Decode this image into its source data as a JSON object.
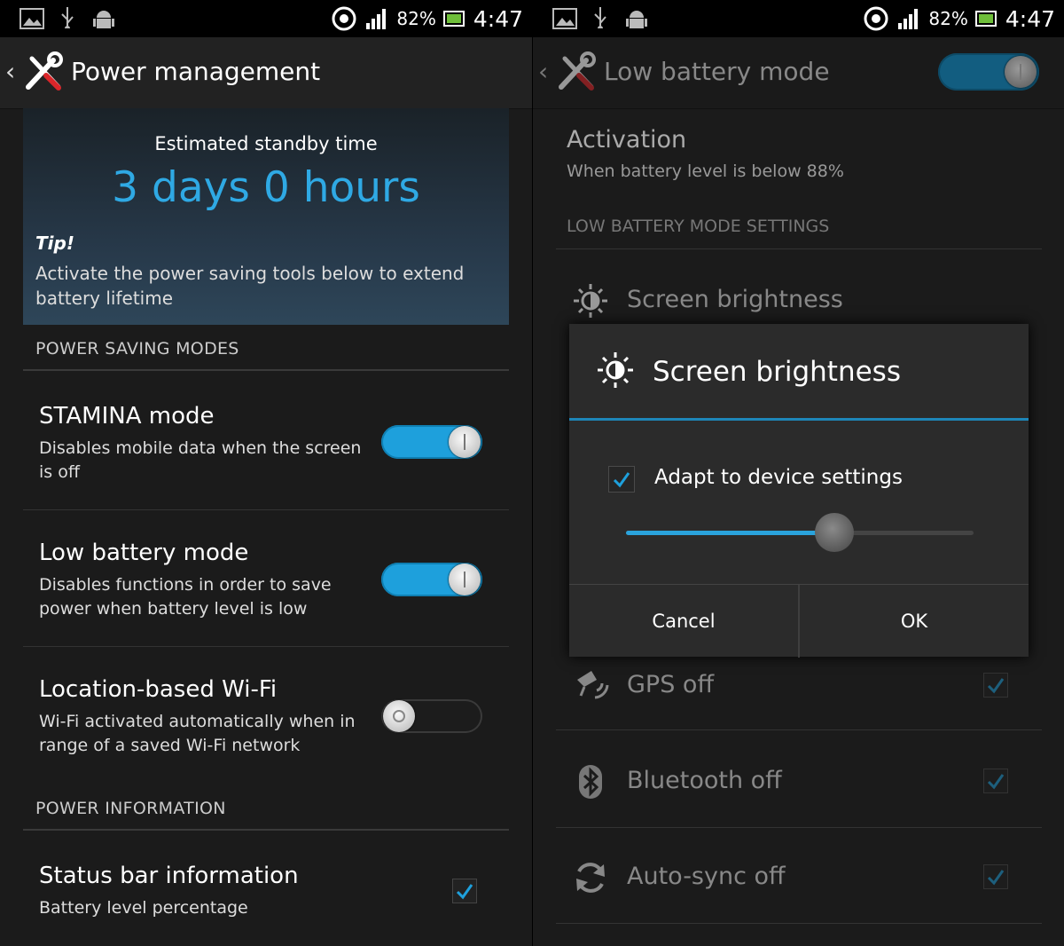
{
  "status_bar": {
    "battery_percent": "82%",
    "time": "4:47",
    "icons": [
      "image-icon",
      "usb-icon",
      "android-icon",
      "sync-icon",
      "signal-icon",
      "battery-icon"
    ]
  },
  "left": {
    "action_bar": {
      "title": "Power management"
    },
    "standby": {
      "label": "Estimated standby time",
      "value": "3 days 0 hours",
      "tip_title": "Tip!",
      "tip_text": "Activate the power saving tools below to extend battery lifetime"
    },
    "power_saving_modes_header": "POWER SAVING MODES",
    "items": [
      {
        "title": "STAMINA mode",
        "subtitle": "Disables mobile data when the screen is off",
        "enabled": true
      },
      {
        "title": "Low battery mode",
        "subtitle": "Disables functions in order to save power when battery level is low",
        "enabled": true
      },
      {
        "title": "Location-based Wi-Fi",
        "subtitle": "Wi-Fi activated automatically when in range of a saved Wi-Fi network",
        "enabled": false
      }
    ],
    "power_information_header": "POWER INFORMATION",
    "status_bar_info": {
      "title": "Status bar information",
      "subtitle": "Battery level percentage",
      "checked": true
    }
  },
  "right": {
    "action_bar": {
      "title": "Low battery mode",
      "enabled": true
    },
    "activation": {
      "title": "Activation",
      "subtitle": "When battery level is below 88%"
    },
    "settings_header": "LOW BATTERY MODE SETTINGS",
    "items": [
      {
        "label": "Screen brightness",
        "icon": "brightness-icon"
      },
      {
        "label": "GPS off",
        "icon": "gps-icon",
        "checked": true
      },
      {
        "label": "Bluetooth off",
        "icon": "bluetooth-icon",
        "checked": true
      },
      {
        "label": "Auto-sync off",
        "icon": "sync-icon",
        "checked": true
      }
    ],
    "dialog": {
      "title": "Screen brightness",
      "adapt_label": "Adapt to device settings",
      "adapt_checked": true,
      "brightness_level": 0.6,
      "cancel_label": "Cancel",
      "ok_label": "OK"
    }
  },
  "colors": {
    "accent": "#1ea0dc",
    "hero_value": "#2fa9e4"
  }
}
